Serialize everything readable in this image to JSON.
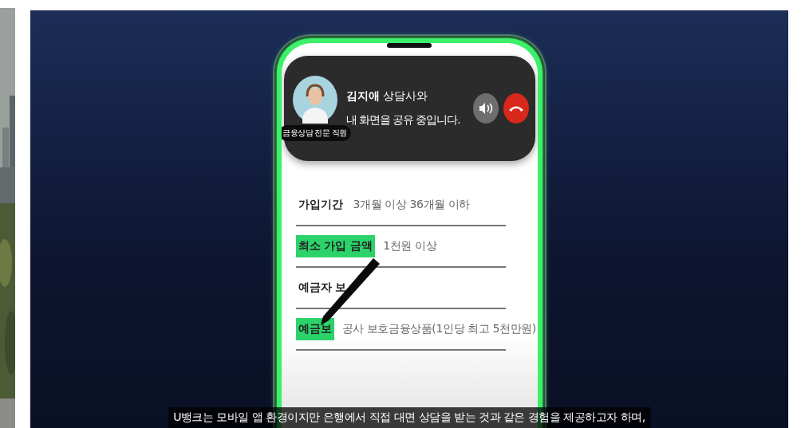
{
  "call_banner": {
    "badge": "금융상담 전문 직원",
    "title": "**김지애** 상담사와",
    "subtitle": "내 화면을 공유 중입니다."
  },
  "rows": [
    {
      "label": "가입기간",
      "value": "3개월 이상 36개월 이하",
      "highlighted": false
    },
    {
      "label": "최소 가입 금액",
      "value": "1천원 이상",
      "highlighted": true
    },
    {
      "label": "예금자 보",
      "highlighted": false
    },
    {
      "label": "예금보",
      "value": "공사 보호금융상품(1인당 최고 5천만원)",
      "highlighted": true
    }
  ],
  "caption": "U뱅크는 모바일 앱 환경이지만 은행에서 직접 대면 상담을 받는 것과 같은 경험을 제공하고자 하며,"
}
